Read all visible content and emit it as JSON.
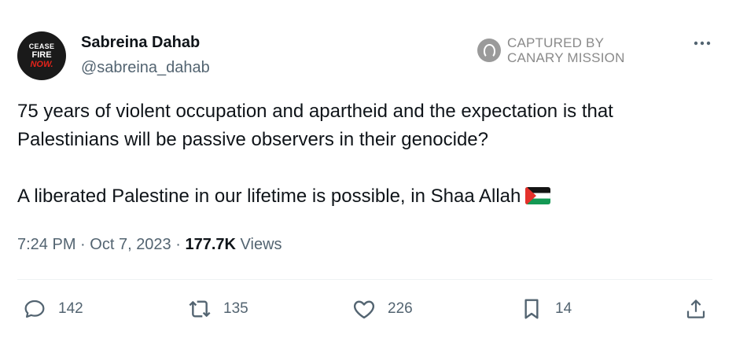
{
  "author": {
    "display_name": "Sabreina Dahab",
    "handle": "@sabreina_dahab",
    "avatar": {
      "line1": "CEASE",
      "line2": "FIRE",
      "line3": "NOW."
    }
  },
  "watermark": {
    "line1": "CAPTURED BY",
    "line2": "CANARY MISSION"
  },
  "more_icon": "more-horizontal-icon",
  "tweet": {
    "paragraph1": "75 years of violent occupation and apartheid and the expectation is that Palestinians will be passive observers in their genocide?",
    "paragraph2": "A liberated Palestine in our lifetime is possible, in Shaa Allah",
    "emoji": "palestine-flag-emoji"
  },
  "meta": {
    "time": "7:24 PM",
    "separator": "·",
    "date": "Oct 7, 2023",
    "views_count": "177.7K",
    "views_label": "Views"
  },
  "actions": {
    "replies": "142",
    "reposts": "135",
    "likes": "226",
    "bookmarks": "14"
  },
  "colors": {
    "text_primary": "#0f1419",
    "text_secondary": "#536471",
    "divider": "#eff3f4",
    "watermark": "#8a8a8a",
    "avatar_accent": "#e2231a"
  }
}
